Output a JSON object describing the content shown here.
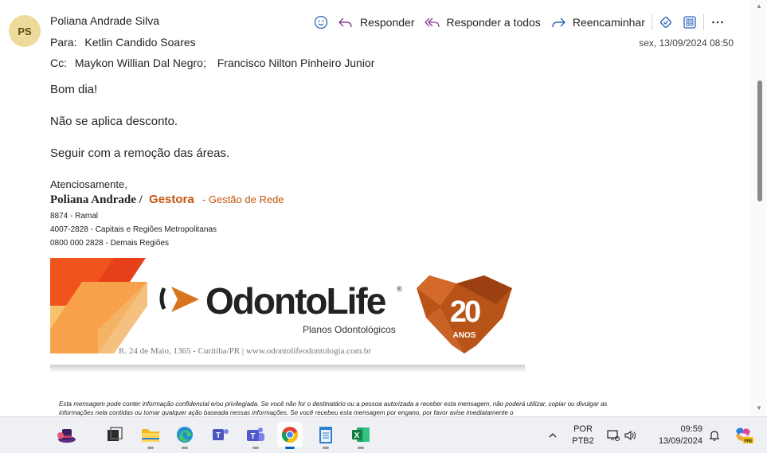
{
  "email": {
    "sender_initials": "PS",
    "sender_name": "Poliana Andrade Silva",
    "to_label": "Para:",
    "to_recipients": "Ketlin Candido Soares",
    "cc_label": "Cc:",
    "cc_recipients": [
      "Maykon Willian Dal Negro;",
      "Francisco Nilton Pinheiro Junior"
    ],
    "date": "sex, 13/09/2024 08:50"
  },
  "toolbar": {
    "reply": "Responder",
    "reply_all": "Responder a todos",
    "forward": "Reencaminhar"
  },
  "body": {
    "greeting": "Bom dia!",
    "paragraphs": [
      "Não se aplica desconto.",
      "Seguir com a remoção das áreas."
    ]
  },
  "signature": {
    "closing": "Atenciosamente,",
    "name": "Poliana Andrade /",
    "role": "Gestora",
    "department": "- Gestão de Rede",
    "lines": [
      "8874 - Ramal",
      "4007-2828 - Capitais e Regiões Metropolitanas",
      "0800 000 2828 - Demais Regiões"
    ],
    "logo_text": "OdontoLife",
    "logo_sub": "Planos Odontológicos",
    "address": "R. 24 de Maio, 1365 - Curitiba/PR  |  www.odontolifeodontologia.com.br",
    "badge_number": "20",
    "badge_text": "ANOS"
  },
  "disclaimer": "Esta mensagem pode conter informação confidencial e/ou privilegiada. Se você não for o destinatário ou a pessoa autorizada a receber esta mensagem, não poderá utilizar, copiar ou divulgar as informações nela contidas ou tomar qualquer ação baseada nessas informações. Se você recebeu esta mensagem por engano, por favor avise imediatamente o",
  "taskbar": {
    "language": "POR",
    "keyboard": "PTB2",
    "time": "09:59",
    "date": "13/09/2024",
    "copilot_badge": "PRE"
  },
  "colors": {
    "accent": "#0067c0",
    "brand_orange": "#c5550f",
    "avatar_bg": "#ecdb9b"
  }
}
